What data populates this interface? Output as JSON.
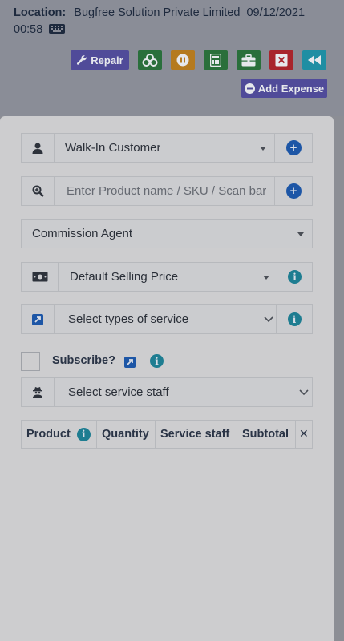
{
  "header": {
    "location_label": "Location:",
    "location_value": "Bugfree Solution Private Limited",
    "datetime_date": "09/12/2021",
    "datetime_time": "00:58"
  },
  "toolbar": {
    "repair_label": "Repair",
    "add_expense_label": "Add Expense"
  },
  "form": {
    "customer": {
      "value": "Walk-In Customer"
    },
    "product_search": {
      "placeholder": "Enter Product name / SKU / Scan bar code"
    },
    "commission_agent": {
      "value": "Commission Agent"
    },
    "price_group": {
      "value": "Default Selling Price"
    },
    "service_types": {
      "value": "Select types of service"
    },
    "subscribe": {
      "label": "Subscribe?",
      "checked": false
    },
    "service_staff": {
      "value": "Select service staff"
    }
  },
  "table": {
    "columns": [
      "Product",
      "Quantity",
      "Service staff",
      "Subtotal"
    ],
    "remove_symbol": "✕"
  },
  "colors": {
    "primary_blue": "#1d56a6",
    "info_teal": "#1e7d91",
    "repair_purple": "#504b99",
    "green": "#2a6f3b",
    "orange": "#b57a1e",
    "red": "#a8242c",
    "cyan": "#1f8ea3"
  }
}
